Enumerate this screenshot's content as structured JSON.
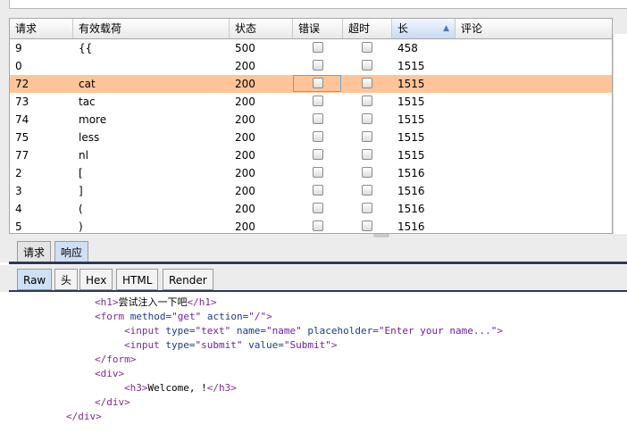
{
  "table": {
    "columns": [
      "请求",
      "有效载荷",
      "状态",
      "错误",
      "超时",
      "长",
      "评论"
    ],
    "sorted_column": "长",
    "rows": [
      {
        "request": "9",
        "payload": "{{",
        "status": "500",
        "length": "458"
      },
      {
        "request": "0",
        "payload": "",
        "status": "200",
        "length": "1515"
      },
      {
        "request": "72",
        "payload": "cat",
        "status": "200",
        "length": "1515"
      },
      {
        "request": "73",
        "payload": "tac",
        "status": "200",
        "length": "1515"
      },
      {
        "request": "74",
        "payload": "more",
        "status": "200",
        "length": "1515"
      },
      {
        "request": "75",
        "payload": "less",
        "status": "200",
        "length": "1515"
      },
      {
        "request": "77",
        "payload": "nl",
        "status": "200",
        "length": "1515"
      },
      {
        "request": "2",
        "payload": "[",
        "status": "200",
        "length": "1516"
      },
      {
        "request": "3",
        "payload": "]",
        "status": "200",
        "length": "1516"
      },
      {
        "request": "4",
        "payload": "(",
        "status": "200",
        "length": "1516"
      },
      {
        "request": "5",
        "payload": ")",
        "status": "200",
        "length": "1516"
      }
    ],
    "selected_row_request": "72",
    "selected_color": "#ffc599"
  },
  "tabs_top": {
    "request": "请求",
    "response": "响应",
    "active": "响应"
  },
  "tabs_view": {
    "raw": "Raw",
    "headers": "头",
    "hex": "Hex",
    "html": "HTML",
    "render": "Render",
    "active": "Raw"
  },
  "code": {
    "l1_open": "<h1>",
    "l1_text": "尝试注入一下吧",
    "l1_close": "</h1>",
    "l2_tag": "<form",
    "l2_a1": "method=",
    "l2_v1": "\"get\"",
    "l2_a2": "action=",
    "l2_v2": "\"/\"",
    "l2_end": ">",
    "l3_tag": "<input",
    "l3_a1": "type=",
    "l3_v1": "\"text\"",
    "l3_a2": "name=",
    "l3_v2": "\"name\"",
    "l3_a3": "placeholder=",
    "l3_v3": "\"Enter your name...\"",
    "l3_end": ">",
    "l4_tag": "<input",
    "l4_a1": "type=",
    "l4_v1": "\"submit\"",
    "l4_a2": "value=",
    "l4_v2": "\"Submit\"",
    "l4_end": ">",
    "l5": "</form>",
    "l6": "<div>",
    "l7_open": "<h3>",
    "l7_text": "Welcome, !",
    "l7_close": "</h3>",
    "l8": "</div>",
    "l9": "</div>"
  },
  "colors": {
    "tag": "#7b2d8f",
    "attr": "#1f3a8a",
    "value": "#6b1fa3",
    "tab_active": "#cfe0f5"
  }
}
